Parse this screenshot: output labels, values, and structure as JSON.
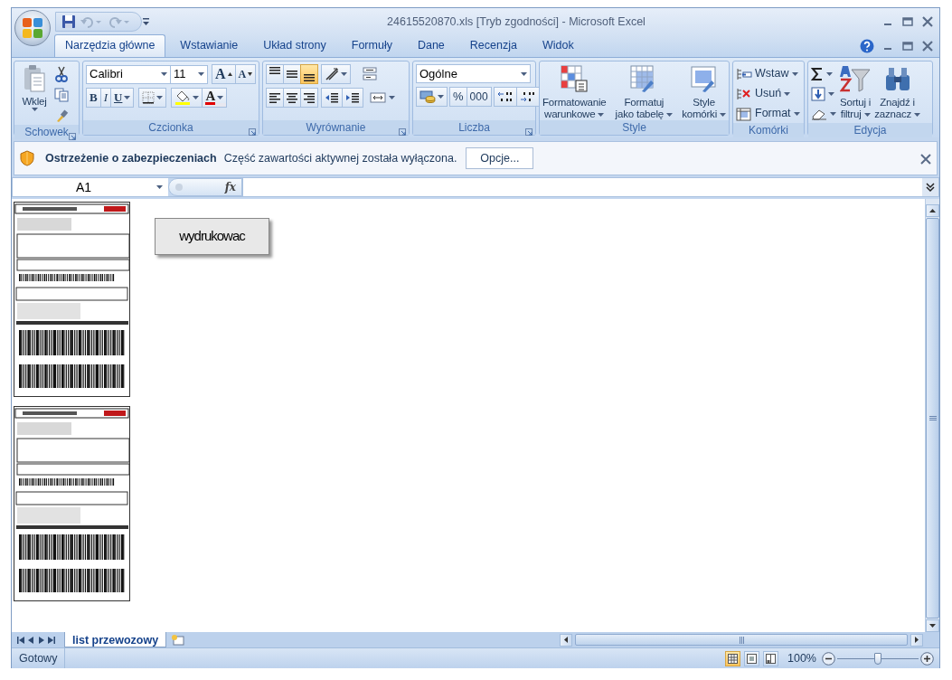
{
  "window": {
    "title": "24615520870.xls  [Tryb zgodności] - Microsoft Excel"
  },
  "tabs": [
    {
      "label": "Narzędzia główne",
      "selected": true
    },
    {
      "label": "Wstawianie",
      "selected": false
    },
    {
      "label": "Układ strony",
      "selected": false
    },
    {
      "label": "Formuły",
      "selected": false
    },
    {
      "label": "Dane",
      "selected": false
    },
    {
      "label": "Recenzja",
      "selected": false
    },
    {
      "label": "Widok",
      "selected": false
    }
  ],
  "ribbon": {
    "clipboard": {
      "label": "Schowek",
      "paste": "Wklej"
    },
    "font": {
      "label": "Czcionka",
      "font_name": "Calibri",
      "font_size": "11",
      "grow": "A",
      "shrink": "A",
      "bold": "B",
      "italic": "I",
      "underline": "U",
      "font_color": "A"
    },
    "alignment": {
      "label": "Wyrównanie",
      "vertical_align": [
        {
          "selected": false
        },
        {
          "selected": false
        },
        {
          "selected": true
        }
      ]
    },
    "number": {
      "label": "Liczba",
      "format": "Ogólne",
      "percent": "%",
      "thousands": "000"
    },
    "styles": {
      "label": "Style",
      "buttons": [
        [
          "Formatowanie",
          "warunkowe"
        ],
        [
          "Formatuj",
          "jako tabelę"
        ],
        [
          "Style",
          "komórki"
        ]
      ]
    },
    "cells": {
      "label": "Komórki",
      "buttons": [
        "Wstaw",
        "Usuń",
        "Format"
      ]
    },
    "editing": {
      "label": "Edycja",
      "buttons": [
        [
          "Sortuj i",
          "filtruj"
        ],
        [
          "Znajdź i",
          "zaznacz"
        ]
      ]
    }
  },
  "security_bar": {
    "title": "Ostrzeżenie o zabezpieczeniach",
    "message": "Część zawartości aktywnej została wyłączona.",
    "button": "Opcje..."
  },
  "formula_bar": {
    "name_box": "A1",
    "function_label": "fx"
  },
  "sheet": {
    "button": "wydrukowac"
  },
  "sheet_tabs": [
    {
      "label": "list przewozowy",
      "selected": true
    }
  ],
  "status_bar": {
    "status": "Gotowy",
    "views": [
      {
        "selected": true
      },
      {
        "selected": false
      },
      {
        "selected": false
      }
    ],
    "zoom": "100%",
    "zoom_slider": {
      "level": 0.5
    }
  }
}
